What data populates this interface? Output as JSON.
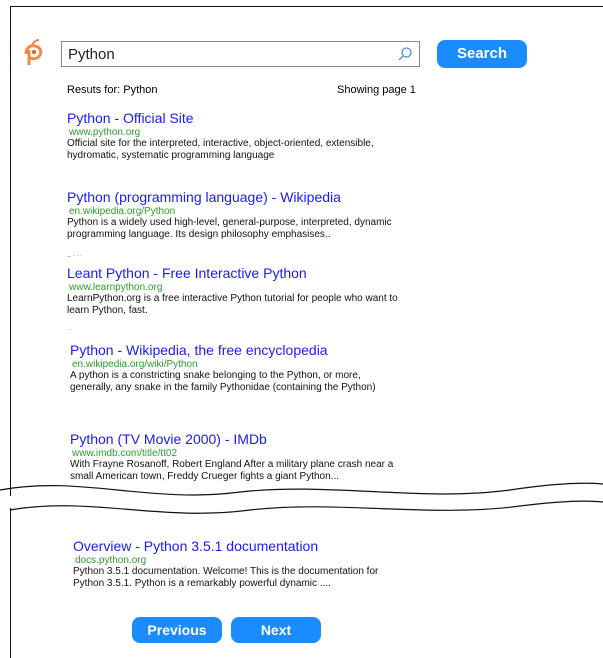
{
  "search": {
    "query": "Python",
    "button_label": "Search"
  },
  "summary": {
    "results_for": "Resuts for: Python",
    "page_info": "Showing page 1"
  },
  "results": [
    {
      "title": "Python - Official Site",
      "url": "www.python.org",
      "description": "Official site for the interpreted, interactive, object-oriented, extensible, hydromatic, systematic programming language"
    },
    {
      "title": "Python (programming language) - Wikipedia",
      "url": "en.wikipedia.org/Python",
      "description": "Python is a widely used high-level, general-purpose, interpreted, dynamic programming language. Its design philosophy emphasises.."
    },
    {
      "title": "Leant Python - Free Interactive Python",
      "url": "www.learnpython.org",
      "description": "LearnPython.org is a free interactive Python tutorial for people who want to learn Python, fast."
    },
    {
      "title": "Python - Wikipedia, the free encyclopedia",
      "url": "en.wikipedia.org/wiki/Python",
      "description": "A python is a constricting snake belonging to the Python, or more, generally, any snake in the family Pythonidae (containing the Python)"
    },
    {
      "title": "Python (TV Movie 2000) - IMDb",
      "url": "www.imdb.com/title/tt02",
      "description": "With Frayne Rosanoff, Robert England  After a military plane crash near a small American town, Freddy Crueger fights a giant Python..."
    },
    {
      "title": "Overview - Python 3.5.1 documentation",
      "url": "docs.python.org",
      "description": "Python 3.5.1 documentation. Welcome! This is the documentation for Python 3.5.1. Python is a remarkably powerful dynamic ...."
    }
  ],
  "pagination": {
    "previous_label": "Previous",
    "next_label": "Next"
  },
  "colors": {
    "accent": "#1a8cff",
    "link": "#1a1aff",
    "url": "#2c9e2c"
  }
}
